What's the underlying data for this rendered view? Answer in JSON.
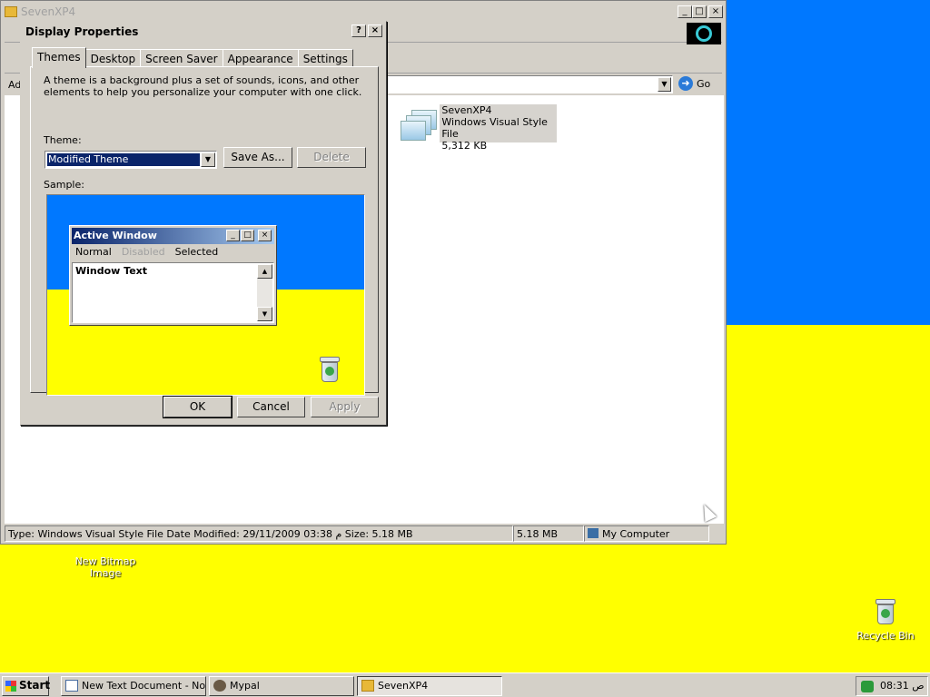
{
  "explorer": {
    "title": "SevenXP4",
    "address_label": "Ad",
    "go_label": "Go",
    "file": {
      "name": "SevenXP4",
      "type": "Windows Visual Style File",
      "size": "5,312 KB"
    },
    "status": {
      "info": "Type: Windows Visual Style File Date Modified: 29/11/2009 03:38 م Size: 5.18 MB",
      "size": "5.18 MB",
      "zone": "My Computer"
    }
  },
  "dialog": {
    "title": "Display Properties",
    "help_btn": "?",
    "close_btn": "×",
    "tabs": [
      "Themes",
      "Desktop",
      "Screen Saver",
      "Appearance",
      "Settings"
    ],
    "description": "A theme is a background plus a set of sounds, icons, and other elements to help you personalize your computer with one click.",
    "theme_label": "Theme:",
    "theme_value": "Modified Theme",
    "save_as": "Save As...",
    "delete": "Delete",
    "sample_label": "Sample:",
    "sample": {
      "window_title": "Active Window",
      "menu": [
        "Normal",
        "Disabled",
        "Selected"
      ],
      "window_text": "Window Text"
    },
    "ok": "OK",
    "cancel": "Cancel",
    "apply": "Apply"
  },
  "desktop": {
    "icons": [
      {
        "label_1": "New Bitmap",
        "label_2": "Image"
      },
      {
        "label_1": "Recycle Bin"
      }
    ],
    "colors": {
      "top": "#0078ff",
      "bottom": "#ffff00"
    }
  },
  "taskbar": {
    "start": "Start",
    "tasks": [
      {
        "label": "New Text Document - No..."
      },
      {
        "label": "Mypal"
      },
      {
        "label": "SevenXP4"
      }
    ],
    "clock": "08:31 ص"
  }
}
